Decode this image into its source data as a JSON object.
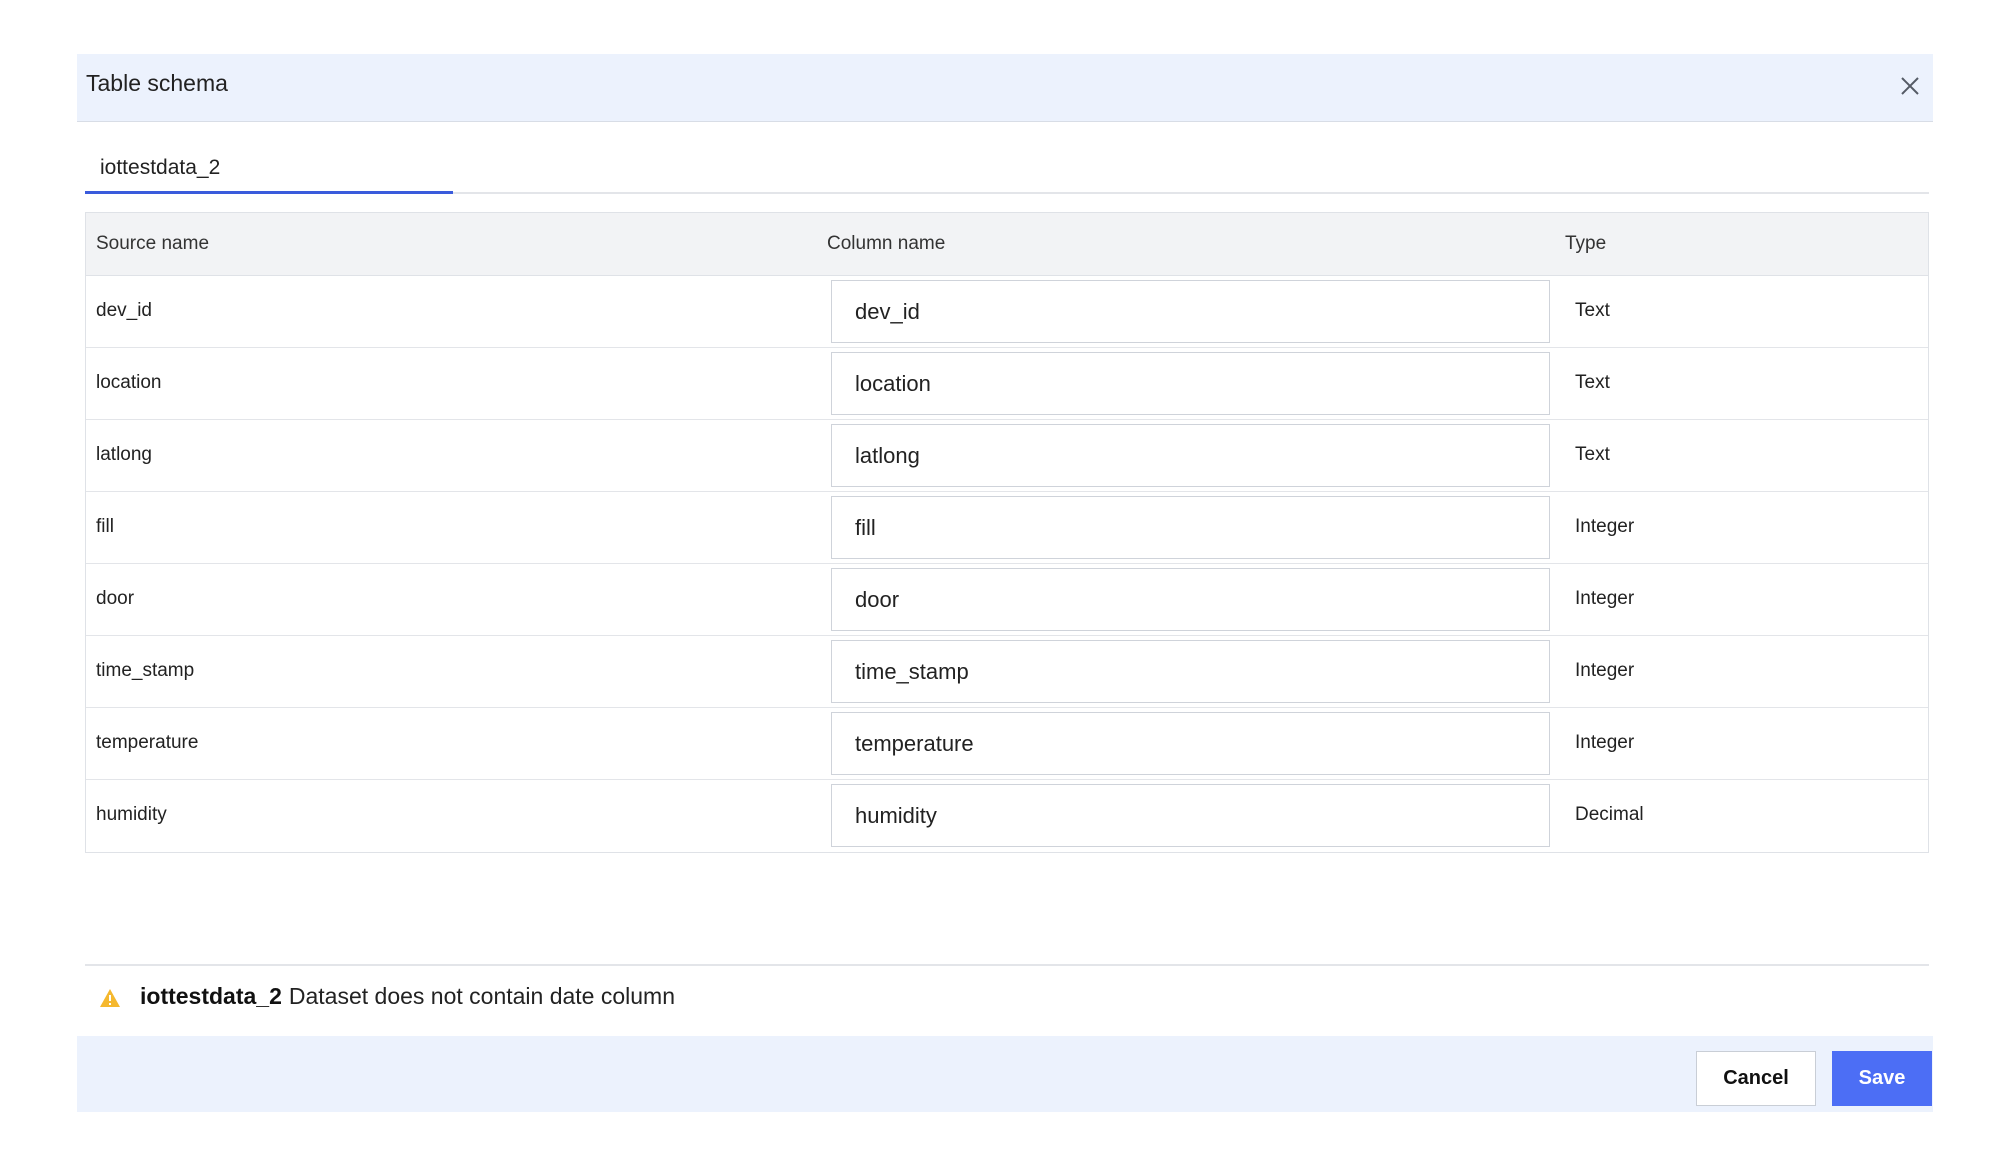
{
  "dialog": {
    "title": "Table schema",
    "close_icon": "close-icon"
  },
  "tabs": [
    {
      "label": "iottestdata_2",
      "active": true
    }
  ],
  "table": {
    "headers": {
      "source": "Source name",
      "column": "Column name",
      "type": "Type"
    },
    "rows": [
      {
        "source": "dev_id",
        "column": "dev_id",
        "type": "Text"
      },
      {
        "source": "location",
        "column": "location",
        "type": "Text"
      },
      {
        "source": "latlong",
        "column": "latlong",
        "type": "Text"
      },
      {
        "source": "fill",
        "column": "fill",
        "type": "Integer"
      },
      {
        "source": "door",
        "column": "door",
        "type": "Integer"
      },
      {
        "source": "time_stamp",
        "column": "time_stamp",
        "type": "Integer"
      },
      {
        "source": "temperature",
        "column": "temperature",
        "type": "Integer"
      },
      {
        "source": "humidity",
        "column": "humidity",
        "type": "Decimal"
      }
    ]
  },
  "warning": {
    "icon": "warning-icon",
    "dataset": "iottestdata_2",
    "message": "Dataset does not contain date column"
  },
  "actions": {
    "cancel_label": "Cancel",
    "save_label": "Save"
  },
  "colors": {
    "header_bg": "#ecf2fd",
    "accent": "#4c6ef5",
    "tab_underline": "#3a5bdc",
    "warning": "#f5b82e"
  }
}
